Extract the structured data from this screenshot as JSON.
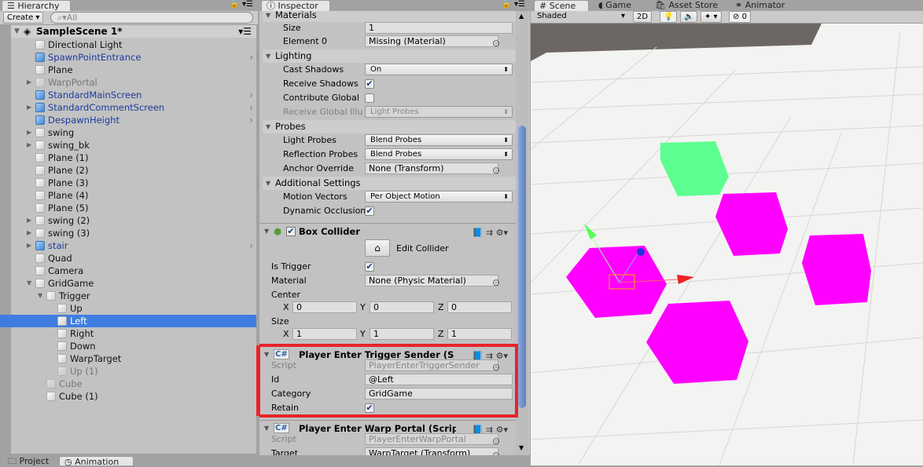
{
  "hierarchy": {
    "tab": "Hierarchy",
    "create": "Create",
    "search_placeholder": "All",
    "scene": "SampleScene 1*",
    "items": [
      {
        "label": "Directional Light",
        "depth": 1,
        "type": "normal"
      },
      {
        "label": "SpawnPointEntrance",
        "depth": 1,
        "type": "prefab",
        "chev": true
      },
      {
        "label": "Plane",
        "depth": 1,
        "type": "normal"
      },
      {
        "label": "WarpPortal",
        "depth": 1,
        "type": "inactive",
        "arrow": "▶"
      },
      {
        "label": "StandardMainScreen",
        "depth": 1,
        "type": "prefab",
        "chev": true
      },
      {
        "label": "StandardCommentScreen",
        "depth": 1,
        "type": "prefab",
        "arrow": "▶",
        "chev": true
      },
      {
        "label": "DespawnHeight",
        "depth": 1,
        "type": "prefab",
        "chev": true
      },
      {
        "label": "swing",
        "depth": 1,
        "type": "normal",
        "arrow": "▶"
      },
      {
        "label": "swing_bk",
        "depth": 1,
        "type": "normal",
        "arrow": "▶"
      },
      {
        "label": "Plane (1)",
        "depth": 1,
        "type": "normal"
      },
      {
        "label": "Plane (2)",
        "depth": 1,
        "type": "normal"
      },
      {
        "label": "Plane (3)",
        "depth": 1,
        "type": "normal"
      },
      {
        "label": "Plane (4)",
        "depth": 1,
        "type": "normal"
      },
      {
        "label": "Plane (5)",
        "depth": 1,
        "type": "normal"
      },
      {
        "label": "swing (2)",
        "depth": 1,
        "type": "normal",
        "arrow": "▶"
      },
      {
        "label": "swing (3)",
        "depth": 1,
        "type": "normal",
        "arrow": "▶"
      },
      {
        "label": "stair",
        "depth": 1,
        "type": "prefab",
        "arrow": "▶",
        "chev": true
      },
      {
        "label": "Quad",
        "depth": 1,
        "type": "normal"
      },
      {
        "label": "Camera",
        "depth": 1,
        "type": "normal"
      },
      {
        "label": "GridGame",
        "depth": 1,
        "type": "normal",
        "arrow": "▼"
      },
      {
        "label": "Trigger",
        "depth": 2,
        "type": "normal",
        "arrow": "▼"
      },
      {
        "label": "Up",
        "depth": 3,
        "type": "normal"
      },
      {
        "label": "Left",
        "depth": 3,
        "type": "normal",
        "selected": true
      },
      {
        "label": "Right",
        "depth": 3,
        "type": "normal"
      },
      {
        "label": "Down",
        "depth": 3,
        "type": "normal"
      },
      {
        "label": "WarpTarget",
        "depth": 3,
        "type": "normal"
      },
      {
        "label": "Up (1)",
        "depth": 3,
        "type": "inactive"
      },
      {
        "label": "Cube",
        "depth": 2,
        "type": "inactive"
      },
      {
        "label": "Cube (1)",
        "depth": 2,
        "type": "normal"
      }
    ]
  },
  "bottom_tabs": {
    "project": "Project",
    "animation": "Animation"
  },
  "inspector": {
    "tab": "Inspector",
    "materials": {
      "header": "Materials",
      "size_label": "Size",
      "size": "1",
      "element0_label": "Element 0",
      "element0": "Missing (Material)"
    },
    "lighting": {
      "header": "Lighting",
      "cast_label": "Cast Shadows",
      "cast": "On",
      "receive_label": "Receive Shadows",
      "receive": true,
      "contribute_label": "Contribute Global",
      "contribute": false,
      "rgi_label": "Receive Global Illu",
      "rgi": "Light Probes"
    },
    "probes": {
      "header": "Probes",
      "light_label": "Light Probes",
      "light": "Blend Probes",
      "refl_label": "Reflection Probes",
      "refl": "Blend Probes",
      "anchor_label": "Anchor Override",
      "anchor": "None (Transform)"
    },
    "additional": {
      "header": "Additional Settings",
      "motion_label": "Motion Vectors",
      "motion": "Per Object Motion",
      "dyn_label": "Dynamic Occlusion",
      "dyn": true
    },
    "box_collider": {
      "title": "Box Collider",
      "edit": "Edit Collider",
      "trigger_label": "Is Trigger",
      "material_label": "Material",
      "material": "None (Physic Material)",
      "center_label": "Center",
      "center": {
        "x": "0",
        "y": "0",
        "z": "0"
      },
      "size_label": "Size",
      "size": {
        "x": "1",
        "y": "1",
        "z": "1"
      }
    },
    "trigger_sender": {
      "title": "Player Enter Trigger Sender (S",
      "script_label": "Script",
      "script": "PlayerEnterTriggerSender",
      "id_label": "Id",
      "id": "@Left",
      "category_label": "Category",
      "category": "GridGame",
      "retain_label": "Retain",
      "retain": true
    },
    "warp_portal": {
      "title": "Player Enter Warp Portal (Scrip",
      "script_label": "Script",
      "script": "PlayerEnterWarpPortal",
      "target_label": "Target",
      "target": "WarpTarget (Transform)"
    },
    "axis": {
      "x": "X",
      "y": "Y",
      "z": "Z"
    }
  },
  "scene": {
    "tabs": [
      "Scene",
      "Game",
      "Asset Store",
      "Animator"
    ],
    "shading": "Shaded",
    "mode2d": "2D",
    "hidden_count": "0",
    "colors": {
      "magenta": "#ff00ff",
      "green": "#5cff8f",
      "highlight": "#e8232a"
    }
  }
}
